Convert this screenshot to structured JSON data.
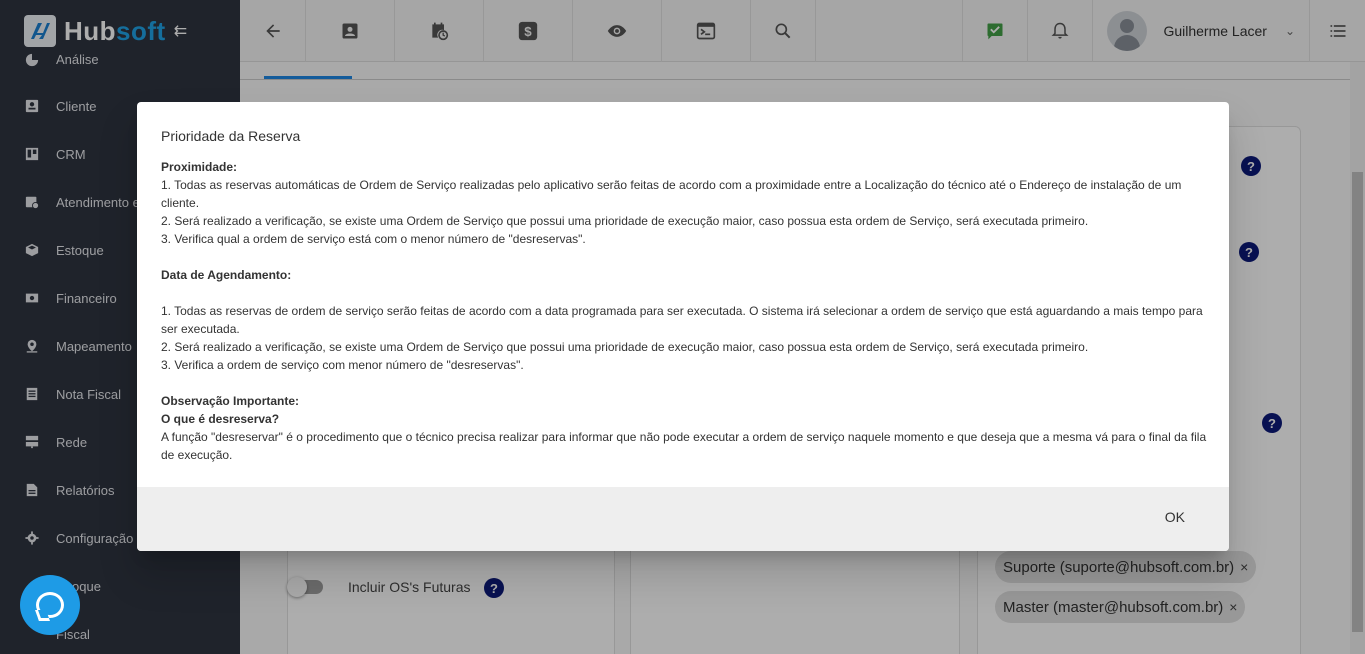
{
  "brand": {
    "name_part1": "Hub",
    "name_part2": "soft",
    "collapse_icon": "collapse-arrow-icon"
  },
  "sidebar": {
    "items": [
      {
        "label": "Análise",
        "icon": "pie-chart-icon"
      },
      {
        "label": "Cliente",
        "icon": "contact-card-icon"
      },
      {
        "label": "CRM",
        "icon": "board-icon"
      },
      {
        "label": "Atendimento e",
        "icon": "calendar-clock-icon"
      },
      {
        "label": "Estoque",
        "icon": "cube-icon"
      },
      {
        "label": "Financeiro",
        "icon": "money-icon"
      },
      {
        "label": "Mapeamento",
        "icon": "map-pin-icon"
      },
      {
        "label": "Nota Fiscal",
        "icon": "document-icon"
      },
      {
        "label": "Rede",
        "icon": "server-icon"
      },
      {
        "label": "Relatórios",
        "icon": "report-icon"
      },
      {
        "label": "Configuração",
        "icon": "gear-icon"
      },
      {
        "label": "oque",
        "icon": ""
      },
      {
        "label": "Fiscal",
        "icon": ""
      }
    ]
  },
  "topbar": {
    "buttons": [
      "back-arrow-icon",
      "contact-icon",
      "calendar-clock-icon",
      "dollar-icon",
      "eye-icon",
      "terminal-icon",
      "search-icon"
    ],
    "right_buttons": [
      "checklist-icon",
      "bell-icon"
    ],
    "user_name": "Guilherme Lacer",
    "menu_icon": "list-menu-icon"
  },
  "background": {
    "toggle_label": "Incluir OS's Futuras",
    "chips": [
      "Suporte (suporte@hubsoft.com.br)",
      "Master (master@hubsoft.com.br)"
    ],
    "chip_close": "×",
    "help_char": "?"
  },
  "dialog": {
    "title": "Prioridade da Reserva",
    "sec1_heading": "Proximidade:",
    "sec1_line1": "1. Todas as reservas automáticas de Ordem de Serviço realizadas pelo aplicativo serão feitas de acordo com a proximidade entre a Localização do técnico até o Endereço de instalação de um cliente.",
    "sec1_line2": "2. Será realizado a verificação, se existe uma Ordem de Serviço que possui uma prioridade de execução maior, caso possua esta ordem de Serviço, será executada primeiro.",
    "sec1_line3": "3. Verifica qual a ordem de serviço está com o menor número de \"desreservas\".",
    "sec2_heading": "Data de Agendamento:",
    "sec2_line1": "1. Todas as reservas de ordem de serviço serão feitas de acordo com a data programada para ser executada. O sistema irá selecionar a ordem de serviço que está aguardando a mais tempo para ser executada.",
    "sec2_line2": "2. Será realizado a verificação, se existe uma Ordem de Serviço que possui uma prioridade de execução maior, caso possua esta ordem de Serviço, será executada primeiro.",
    "sec2_line3": "3. Verifica a ordem de serviço com menor número de \"desreservas\".",
    "sec3_heading": "Observação Importante:",
    "sec3_subheading": "O que é desreserva?",
    "sec3_text": "A função \"desreservar\" é o procedimento que o técnico precisa realizar para informar que não pode executar a ordem de serviço naquele momento e que deseja que a mesma vá para o final da fila de execução.",
    "ok_label": "OK"
  }
}
